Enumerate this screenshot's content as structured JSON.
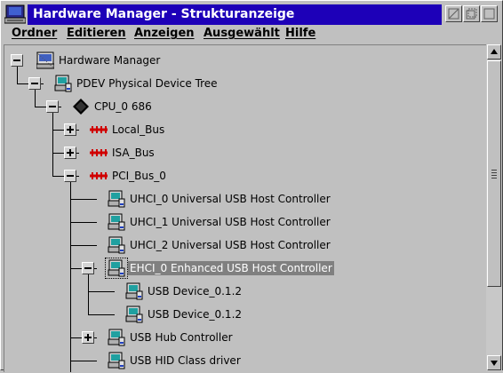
{
  "window": {
    "title": "Hardware Manager - Strukturanzeige",
    "title_bar_color": "#1d00b8",
    "controls": [
      "minimize-icon",
      "restore-icon",
      "close-icon"
    ]
  },
  "menu": {
    "items": [
      "Ordner",
      "Editieren",
      "Anzeigen",
      "Ausgewählt",
      "Hilfe"
    ]
  },
  "tree": {
    "nodes": [
      {
        "label": "Hardware Manager",
        "icon": "computer-icon",
        "expander": "collapse"
      },
      {
        "label": "PDEV Physical Device Tree",
        "icon": "device-icon",
        "expander": "collapse"
      },
      {
        "label": "CPU_0 686",
        "icon": "cpu-chip-icon",
        "expander": "collapse"
      },
      {
        "label": "Local_Bus",
        "icon": "bus-icon",
        "expander": "expand"
      },
      {
        "label": "ISA_Bus",
        "icon": "bus-icon",
        "expander": "expand"
      },
      {
        "label": "PCI_Bus_0",
        "icon": "bus-icon",
        "expander": "collapse"
      },
      {
        "label": "UHCI_0 Universal USB Host Controller",
        "icon": "device-icon",
        "expander": "none"
      },
      {
        "label": "UHCI_1 Universal USB Host Controller",
        "icon": "device-icon",
        "expander": "none"
      },
      {
        "label": "UHCI_2 Universal USB Host Controller",
        "icon": "device-icon",
        "expander": "none"
      },
      {
        "label": "EHCI_0 Enhanced USB Host Controller",
        "icon": "device-icon",
        "expander": "collapse",
        "selected": true
      },
      {
        "label": "USB Device_0.1.2",
        "icon": "device-icon",
        "expander": "none"
      },
      {
        "label": "USB Device_0.1.2",
        "icon": "device-icon",
        "expander": "none"
      },
      {
        "label": "USB Hub Controller",
        "icon": "device-icon",
        "expander": "expand"
      },
      {
        "label": "USB HID Class driver",
        "icon": "device-icon",
        "expander": "none"
      }
    ]
  },
  "scrollbar": {
    "position": 0.0
  }
}
